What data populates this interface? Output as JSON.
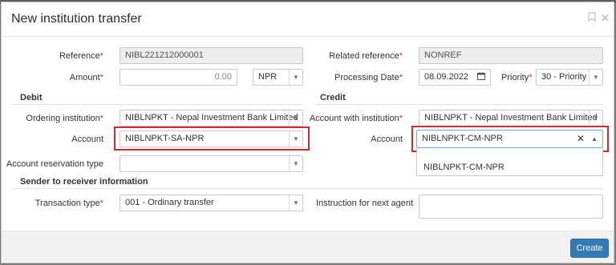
{
  "modal": {
    "title": "New institution transfer",
    "bookmark_icon": "bookmark-icon",
    "close_icon": "close-icon"
  },
  "reference": {
    "label": "Reference",
    "value": "NIBL221212000001"
  },
  "related_reference": {
    "label": "Related reference",
    "value": "NONREF"
  },
  "amount": {
    "label": "Amount",
    "value": "0.00",
    "currency": "NPR"
  },
  "processing_date": {
    "label": "Processing Date",
    "value": "08.09.2022",
    "icon": "calendar-icon"
  },
  "priority": {
    "label": "Priority",
    "value": "30 - Priority"
  },
  "debit": {
    "title": "Debit",
    "ordering_institution": {
      "label": "Ordering institution",
      "value": "NIBLNPKT - Nepal Investment Bank Limited"
    },
    "account": {
      "label": "Account",
      "value": "NIBLNPKT-SA-NPR"
    },
    "account_reservation_type": {
      "label": "Account reservation type",
      "value": ""
    }
  },
  "credit": {
    "title": "Credit",
    "account_with_institution": {
      "label": "Account with institution",
      "value": "NIBLNPKT - Nepal Investment Bank Limited"
    },
    "account": {
      "label": "Account",
      "value": "NIBLNPKT-CM-NPR",
      "clear_glyph": "✕",
      "options": [
        "NIBLNPKT-CM-NPR"
      ]
    }
  },
  "sender_info": {
    "title": "Sender to receiver information",
    "transaction_type": {
      "label": "Transaction type",
      "value": "001 - Ordinary transfer"
    },
    "instruction": {
      "label": "Instruction for next agent",
      "value": ""
    }
  },
  "required_mark": "*",
  "create_label": "Create",
  "colors": {
    "primary": "#337ab7",
    "highlight": "#d9272e",
    "required": "#d2322d"
  }
}
